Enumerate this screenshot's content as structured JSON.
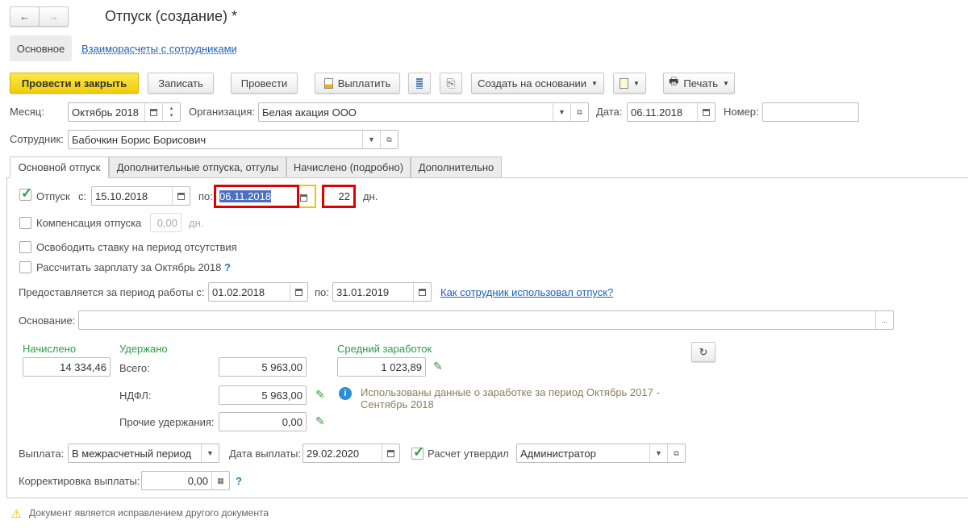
{
  "window": {
    "title": "Отпуск (создание) *"
  },
  "nav": {
    "back": "←",
    "forward": "→"
  },
  "sections": {
    "main": "Основное",
    "settlements": "Взаиморасчеты с сотрудниками"
  },
  "toolbar": {
    "post_close": "Провести и закрыть",
    "save": "Записать",
    "post": "Провести",
    "pay": "Выплатить",
    "create_based": "Создать на основании",
    "print": "Печать"
  },
  "header": {
    "month_label": "Месяц:",
    "month": "Октябрь 2018",
    "org_label": "Организация:",
    "org": "Белая акация ООО",
    "date_label": "Дата:",
    "date": "06.11.2018",
    "number_label": "Номер:",
    "number": "",
    "employee_label": "Сотрудник:",
    "employee": "Бабочкин Борис Борисович"
  },
  "tabs": [
    "Основной отпуск",
    "Дополнительные отпуска, отгулы",
    "Начислено (подробно)",
    "Дополнительно"
  ],
  "main": {
    "vacation_label": "Отпуск",
    "vacation_checked": true,
    "from_label": "с:",
    "from": "15.10.2018",
    "to_label": "по:",
    "to": "06.11.2018",
    "days": "22",
    "days_unit": "дн.",
    "compensation_label": "Компенсация отпуска",
    "compensation": "0,00",
    "compensation_unit": "дн.",
    "free_rate_label": "Освободить ставку на период отсутствия",
    "calc_salary_label": "Рассчитать зарплату за Октябрь 2018",
    "help": "?",
    "period_label": "Предоставляется за период работы с:",
    "period_from": "01.02.2018",
    "period_to_label": "по:",
    "period_to": "31.01.2019",
    "usage_link": "Как сотрудник использовал отпуск?",
    "basis_label": "Основание:",
    "basis": "",
    "basis_btn": "...",
    "accrued_label": "Начислено",
    "accrued": "14 334,46",
    "withheld_label": "Удержано",
    "total_label": "Всего:",
    "total": "5 963,00",
    "ndfl_label": "НДФЛ:",
    "ndfl": "5 963,00",
    "other_label": "Прочие удержания:",
    "other": "0,00",
    "avg_label": "Средний заработок",
    "avg": "1 023,89",
    "info_line1": "Использованы данные о заработке за период Октябрь 2017 -",
    "info_line2": "Сентябрь 2018",
    "payment_label": "Выплата:",
    "payment": "В межрасчетный период",
    "pay_date_label": "Дата выплаты:",
    "pay_date": "29.02.2020",
    "approved_label": "Расчет утвердил",
    "approved_checked": true,
    "approver": "Администратор",
    "adjust_label": "Корректировка выплаты:",
    "adjust": "0,00"
  },
  "footer": {
    "warning": "Документ является исправлением другого документа"
  },
  "colors": {
    "accent": "#f1cc0a",
    "green": "#2e9a4a",
    "link": "#1f5fb5",
    "highlight": "#e00000"
  }
}
